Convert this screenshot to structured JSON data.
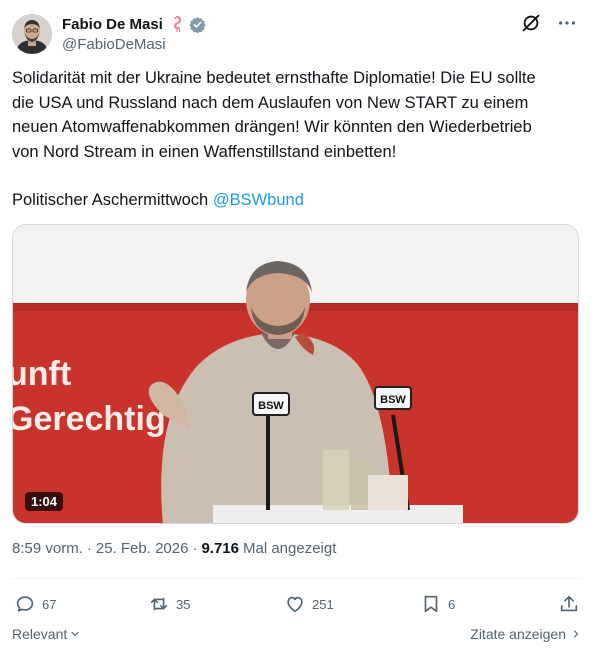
{
  "author": {
    "display_name": "Fabio De Masi",
    "handle": "@FabioDeMasi"
  },
  "tweet": {
    "lines": [
      "Solidarität mit der Ukraine bedeutet ernsthafte Diplomatie! Die EU sollte",
      "die USA und Russland nach dem Auslaufen von New START zu einem",
      "neuen Atomwaffenabkommen drängen! Wir könnten den Wiederbetrieb",
      "von Nord Stream in einen Waffenstillstand einbetten!"
    ],
    "second_para_prefix": "Politischer Aschermittwoch",
    "mention": "@BSWbund"
  },
  "video": {
    "duration": "1:04",
    "banner_line1": "unft",
    "banner_line2": "Gerechtig",
    "mic_label": "BSW"
  },
  "meta": {
    "time": "8:59 vorm.",
    "separator": "·",
    "date": "25. Feb. 2026",
    "views_count": "9.716",
    "views_label": "Mal angezeigt"
  },
  "actions": {
    "replies": "67",
    "reposts": "35",
    "likes": "251",
    "bookmarks": "6"
  },
  "footer": {
    "sort_label": "Relevant",
    "quotes_label": "Zitate anzeigen"
  },
  "colors": {
    "accent": "#1d9bf0",
    "secondary_text": "#536471",
    "banner_red": "#c8342b"
  }
}
